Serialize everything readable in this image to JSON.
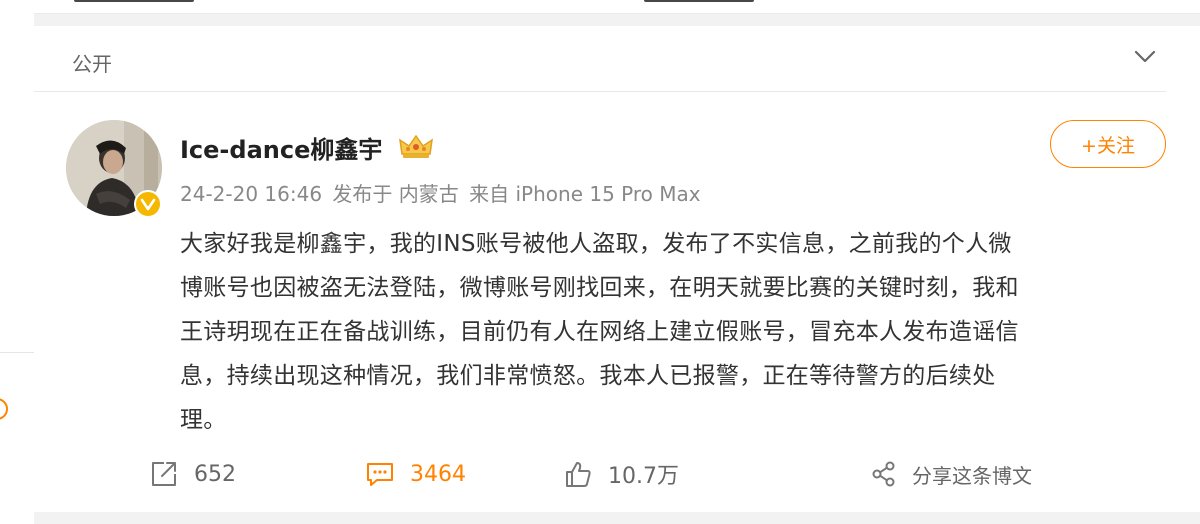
{
  "visibility": {
    "label": "公开"
  },
  "post": {
    "author": "Ice-dance柳鑫宇",
    "follow_label": "+关注",
    "meta": {
      "datetime": "24-2-20 16:46",
      "location": "发布于 内蒙古",
      "source": "来自 iPhone 15 Pro Max"
    },
    "body_lines": [
      "大家好我是柳鑫宇，我的INS账号被他人盗取，发布了不实信息，之前我的个人微",
      "博账号也因被盗无法登陆，微博账号刚找回来，在明天就要比赛的关键时刻，我和",
      "王诗玥现在正在备战训练，目前仍有人在网络上建立假账号，冒充本人发布造谣信",
      "息，持续出现这种情况，我们非常愤怒。我本人已报警，正在等待警方的后续处",
      "理。"
    ]
  },
  "actions": {
    "repost_count": "652",
    "comment_count": "3464",
    "like_count": "10.7万",
    "share_label": "分享这条博文"
  },
  "colors": {
    "accent": "#ff8200",
    "text": "#333333",
    "muted": "#888888",
    "badge": "#f5b700"
  },
  "icons": [
    "chevron-down-icon",
    "verified-badge-icon",
    "crown-icon",
    "repost-icon",
    "comment-icon",
    "like-icon",
    "share-icon"
  ]
}
